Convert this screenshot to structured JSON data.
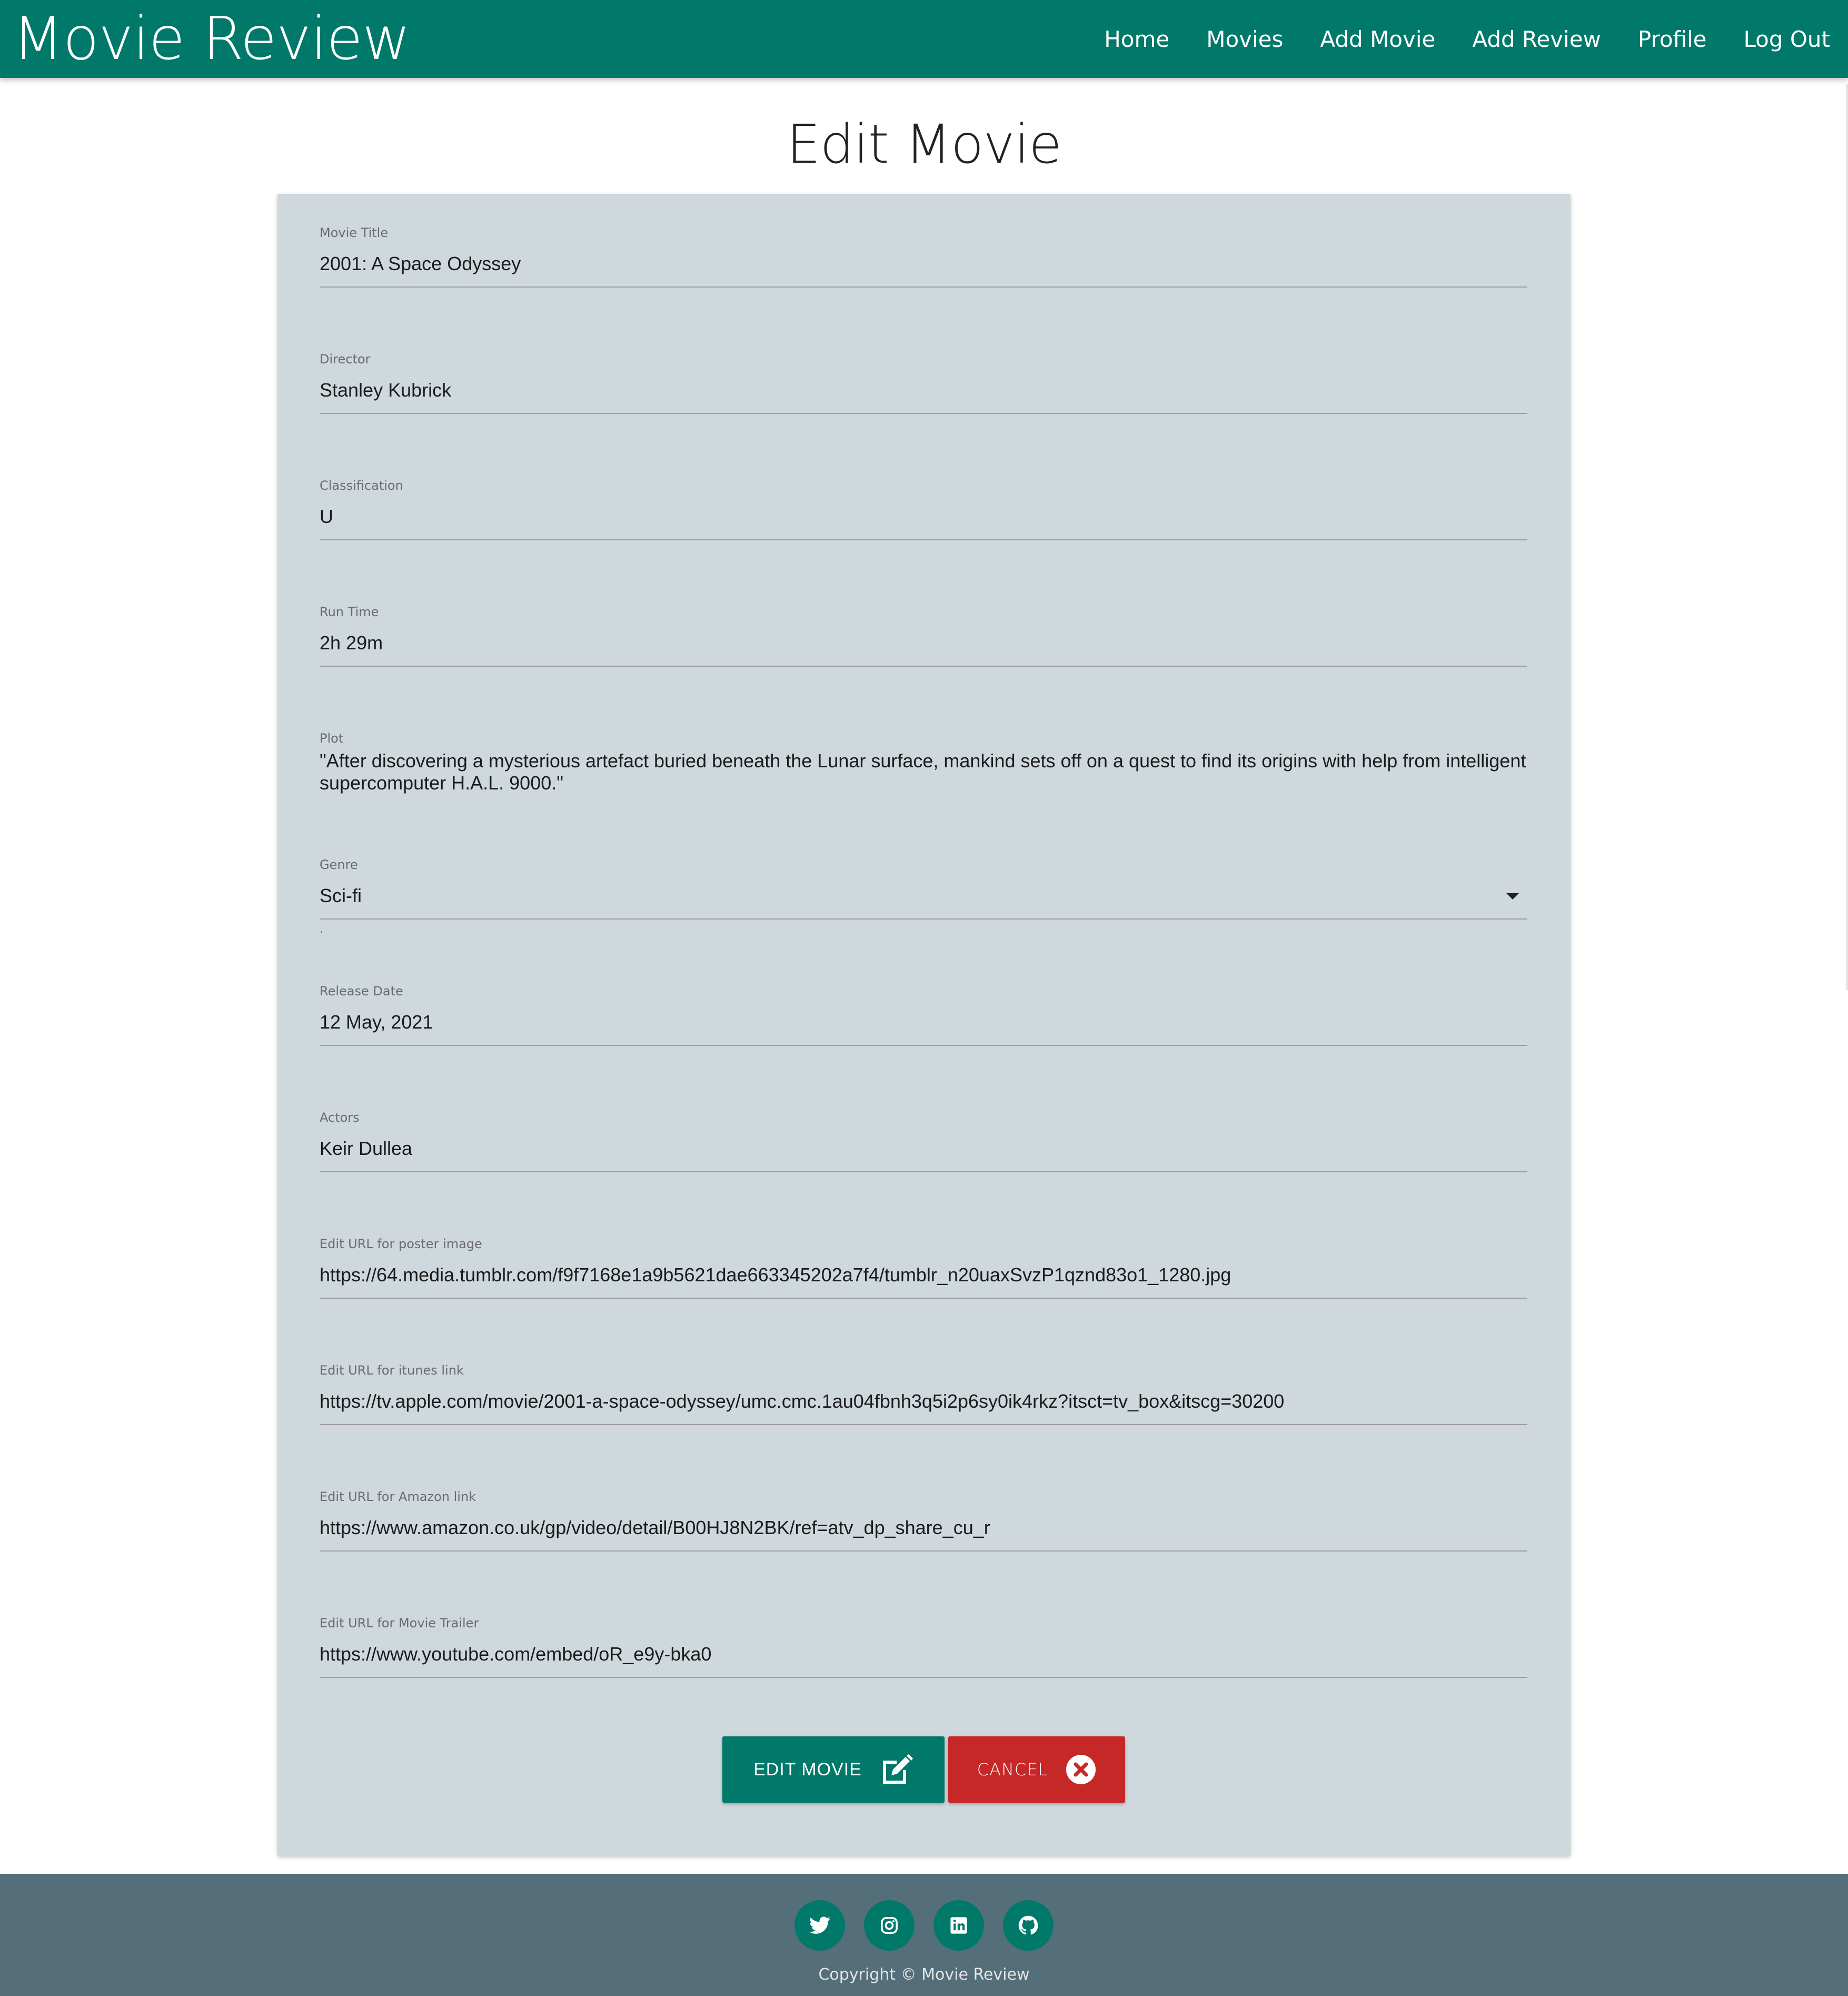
{
  "navbar": {
    "brand": "Movie Review",
    "links": [
      "Home",
      "Movies",
      "Add Movie",
      "Add Review",
      "Profile",
      "Log Out"
    ]
  },
  "page_title": "Edit Movie",
  "form": {
    "fields": [
      {
        "label": "Movie Title",
        "value": "2001: A Space Odyssey"
      },
      {
        "label": "Director",
        "value": "Stanley Kubrick"
      },
      {
        "label": "Classification",
        "value": "U"
      },
      {
        "label": "Run Time",
        "value": "2h 29m"
      },
      {
        "label": "Plot",
        "value": " \"After discovering a mysterious artefact buried beneath the Lunar surface, mankind sets off on a quest to find its origins with help from intelligent supercomputer H.A.L. 9000.\""
      },
      {
        "label": "Genre",
        "value": "Sci-fi"
      },
      {
        "label": "Release Date",
        "value": "12 May, 2021"
      },
      {
        "label": "Actors",
        "value": "Keir Dullea"
      },
      {
        "label": "Edit URL for poster image",
        "value": "https://64.media.tumblr.com/f9f7168e1a9b5621dae663345202a7f4/tumblr_n20uaxSvzP1qznd83o1_1280.jpg"
      },
      {
        "label": "Edit URL for itunes link",
        "value": "https://tv.apple.com/movie/2001-a-space-odyssey/umc.cmc.1au04fbnh3q5i2p6sy0ik4rkz?itsct=tv_box&itscg=30200"
      },
      {
        "label": "Edit URL for Amazon link",
        "value": "https://www.amazon.co.uk/gp/video/detail/B00HJ8N2BK/ref=atv_dp_share_cu_r"
      },
      {
        "label": "Edit URL for Movie Trailer",
        "value": "https://www.youtube.com/embed/oR_e9y-bka0"
      }
    ]
  },
  "buttons": {
    "edit_label": "EDIT MOVIE",
    "cancel_label": "CANCEL"
  },
  "footer": {
    "social_icons": [
      "twitter-icon",
      "instagram-icon",
      "linkedin-icon",
      "github-icon"
    ],
    "copyright": "Copyright © Movie Review"
  },
  "colors": {
    "primary": "#00796b",
    "danger": "#c62828",
    "card_bg": "#cfd8dc",
    "footer_bg": "#546e7a"
  }
}
